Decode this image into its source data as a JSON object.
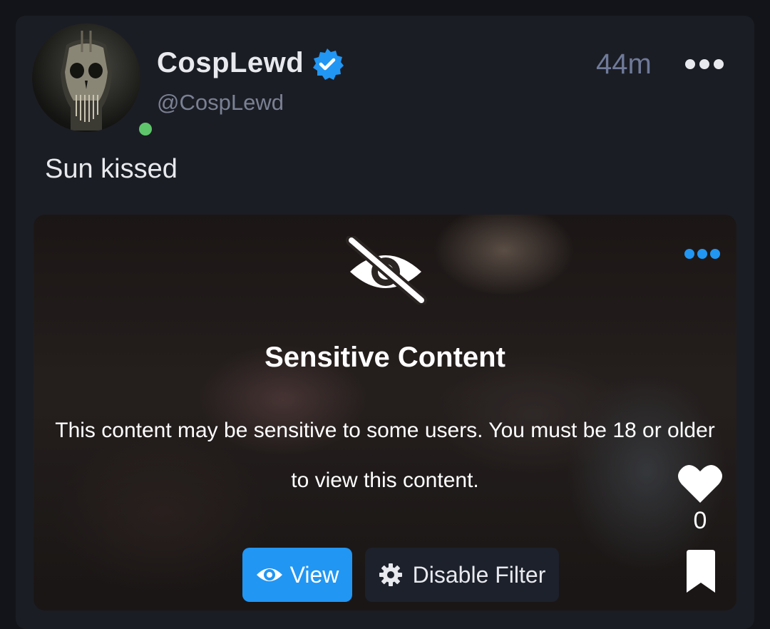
{
  "post": {
    "display_name": "CospLewd",
    "handle": "@CospLewd",
    "timestamp": "44m",
    "caption": "Sun kissed",
    "verified": true,
    "online": true
  },
  "media": {
    "title": "Sensitive Content",
    "message": "This content may be sensitive to some users. You must be 18 or older to view this content.",
    "view_label": "View",
    "disable_filter_label": "Disable Filter",
    "like_count": "0"
  },
  "icons": {
    "verified": "verified-badge-icon",
    "more": "more-horizontal-icon",
    "hidden": "eye-slash-icon",
    "view": "eye-icon",
    "settings": "gear-icon",
    "like": "heart-icon",
    "bookmark": "bookmark-icon"
  },
  "colors": {
    "accent": "#2196f3",
    "online": "#5fc56b",
    "background": "#131419",
    "card": "#1b1d24"
  }
}
